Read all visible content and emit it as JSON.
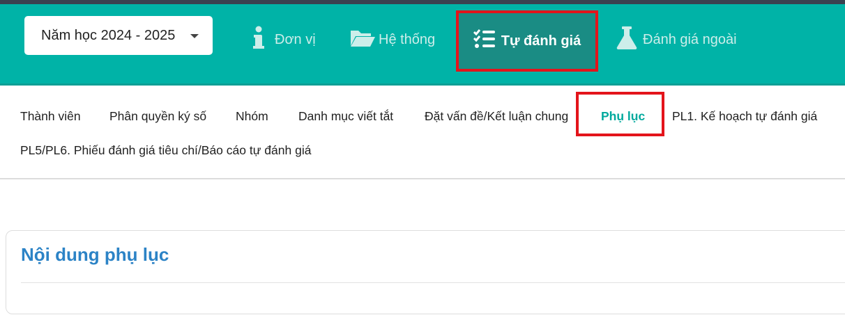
{
  "header": {
    "year_select": {
      "label": "Năm học 2024 - 2025"
    },
    "nav": [
      {
        "label": "Đơn vị",
        "icon": "info-icon"
      },
      {
        "label": "Hệ thống",
        "icon": "folder-open-icon"
      },
      {
        "label": "Tự đánh giá",
        "icon": "checklist-icon",
        "active": true
      },
      {
        "label": "Đánh giá ngoài",
        "icon": "flask-icon"
      }
    ]
  },
  "subnav": {
    "tabs": [
      {
        "label": "Thành viên"
      },
      {
        "label": "Phân quyền ký số"
      },
      {
        "label": "Nhóm"
      },
      {
        "label": "Danh mục viết tắt"
      },
      {
        "label": "Đặt vấn đề/Kết luận chung"
      },
      {
        "label": "Phụ lục",
        "active": true
      },
      {
        "label": "PL1. Kế hoạch tự đánh giá"
      },
      {
        "label": "PL5/PL6. Phiếu đánh giá tiêu chí/Báo cáo tự đánh giá"
      }
    ]
  },
  "content": {
    "title": "Nội dung phụ lục"
  },
  "colors": {
    "header_bg": "#00b3a7",
    "active_nav_bg": "#1a8c84",
    "highlight_border": "#e3141b",
    "active_tab_text": "#00a99d",
    "title_text": "#2c83c6"
  }
}
